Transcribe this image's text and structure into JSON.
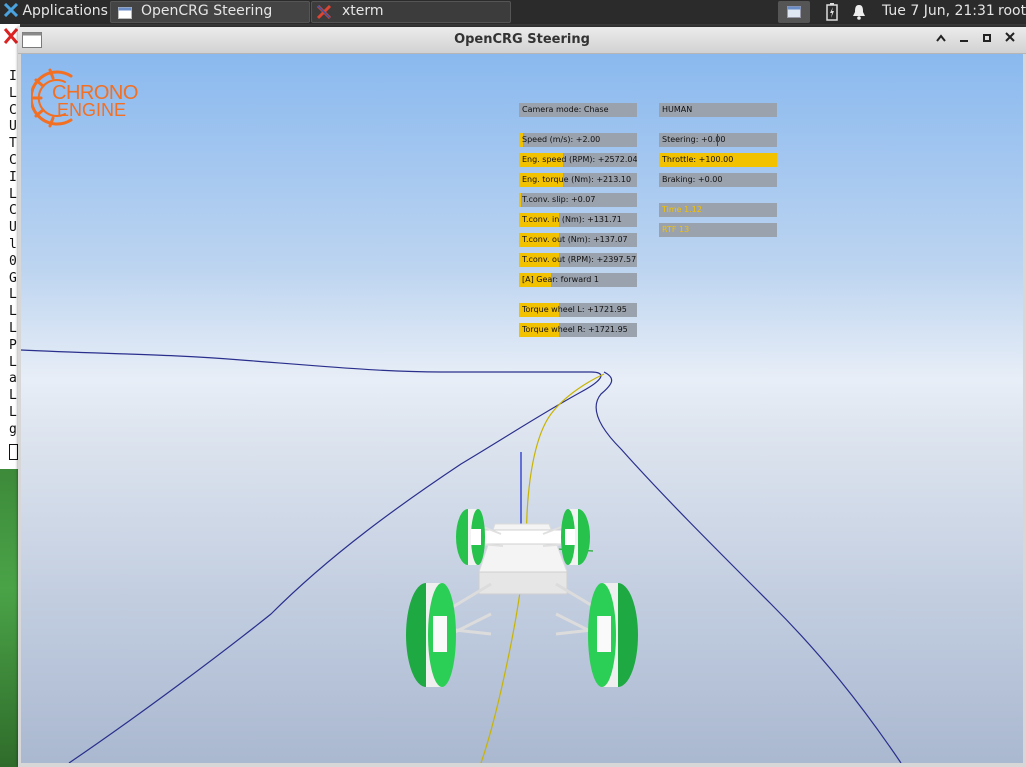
{
  "taskbar": {
    "applications_label": "Applications",
    "tasks": [
      {
        "label": "OpenCRG Steering",
        "icon": "window-icon"
      },
      {
        "label": "xterm",
        "icon": "xterm-x-icon"
      }
    ],
    "clock": "Tue  7 Jun, 21:31",
    "user": "root"
  },
  "xterm": {
    "lines": [
      "I",
      "L",
      "C",
      "U",
      "T",
      "C",
      "I",
      "L",
      "C",
      "U",
      "l",
      "0",
      "G",
      "L",
      "L",
      "L",
      "P",
      "L",
      "a",
      "L",
      "L",
      "g"
    ]
  },
  "window": {
    "title": "OpenCRG Steering"
  },
  "logo": {
    "line1": "CHRONO",
    "line2": "ENGINE",
    "color": "#f36f21"
  },
  "hud": {
    "left": [
      {
        "label": "Camera mode: Chase",
        "fill": 0
      },
      {
        "label": "Speed (m/s): +2.00",
        "fill": 0.03
      },
      {
        "label": "Eng. speed (RPM): +2572.04",
        "fill": 0.37
      },
      {
        "label": "Eng. torque (Nm): +213.10",
        "fill": 0.37
      },
      {
        "label": "T.conv. slip: +0.07",
        "fill": 0.02
      },
      {
        "label": "T.conv. in  (Nm): +131.71",
        "fill": 0.34
      },
      {
        "label": "T.conv. out (Nm): +137.07",
        "fill": 0.34
      },
      {
        "label": "T.conv. out (RPM): +2397.57",
        "fill": 0.34
      },
      {
        "label": "[A]  Gear: forward  1",
        "fill": 0.27
      },
      {
        "label": "Torque wheel L: +1721.95",
        "fill": 0.34
      },
      {
        "label": "Torque wheel R: +1721.95",
        "fill": 0.34
      }
    ],
    "right": [
      {
        "label": "HUMAN",
        "fill": 0
      },
      {
        "label": "Steering: +0.00",
        "fill": 0
      },
      {
        "label": "Throttle: +100.00",
        "fill": 1.0
      },
      {
        "label": "Braking: +0.00",
        "fill": 0
      },
      {
        "label": "Time 1.12",
        "fill": 0
      },
      {
        "label": "RTF  13",
        "fill": 0
      }
    ],
    "bar_color": "#f2c100"
  },
  "colors": {
    "road_edge": "#2a2f8c",
    "centerline": "#c8b400",
    "wheel_green": "#22c24a"
  }
}
